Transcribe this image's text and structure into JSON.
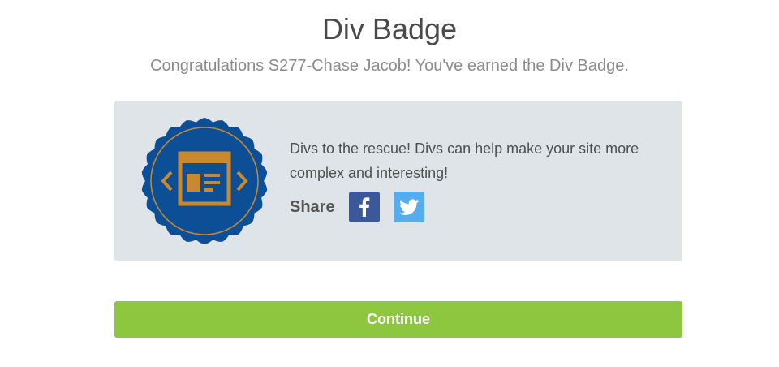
{
  "header": {
    "title": "Div Badge",
    "subtitle": "Congratulations S277-Chase Jacob! You've earned the Div Badge."
  },
  "badge_card": {
    "description": "Divs to the rescue! Divs can help make your site more complex and interesting!",
    "share_label": "Share",
    "badge_icon": "div-badge-seal-icon",
    "share_buttons": [
      {
        "network": "facebook",
        "icon": "facebook-icon",
        "color": "#3b5998"
      },
      {
        "network": "twitter",
        "icon": "twitter-icon",
        "color": "#55acee"
      }
    ],
    "colors": {
      "card_background": "#dee4e8",
      "badge_blue": "#0d4f96",
      "badge_gold": "#c9892e"
    }
  },
  "actions": {
    "continue_label": "Continue",
    "continue_color": "#8dc63f"
  }
}
